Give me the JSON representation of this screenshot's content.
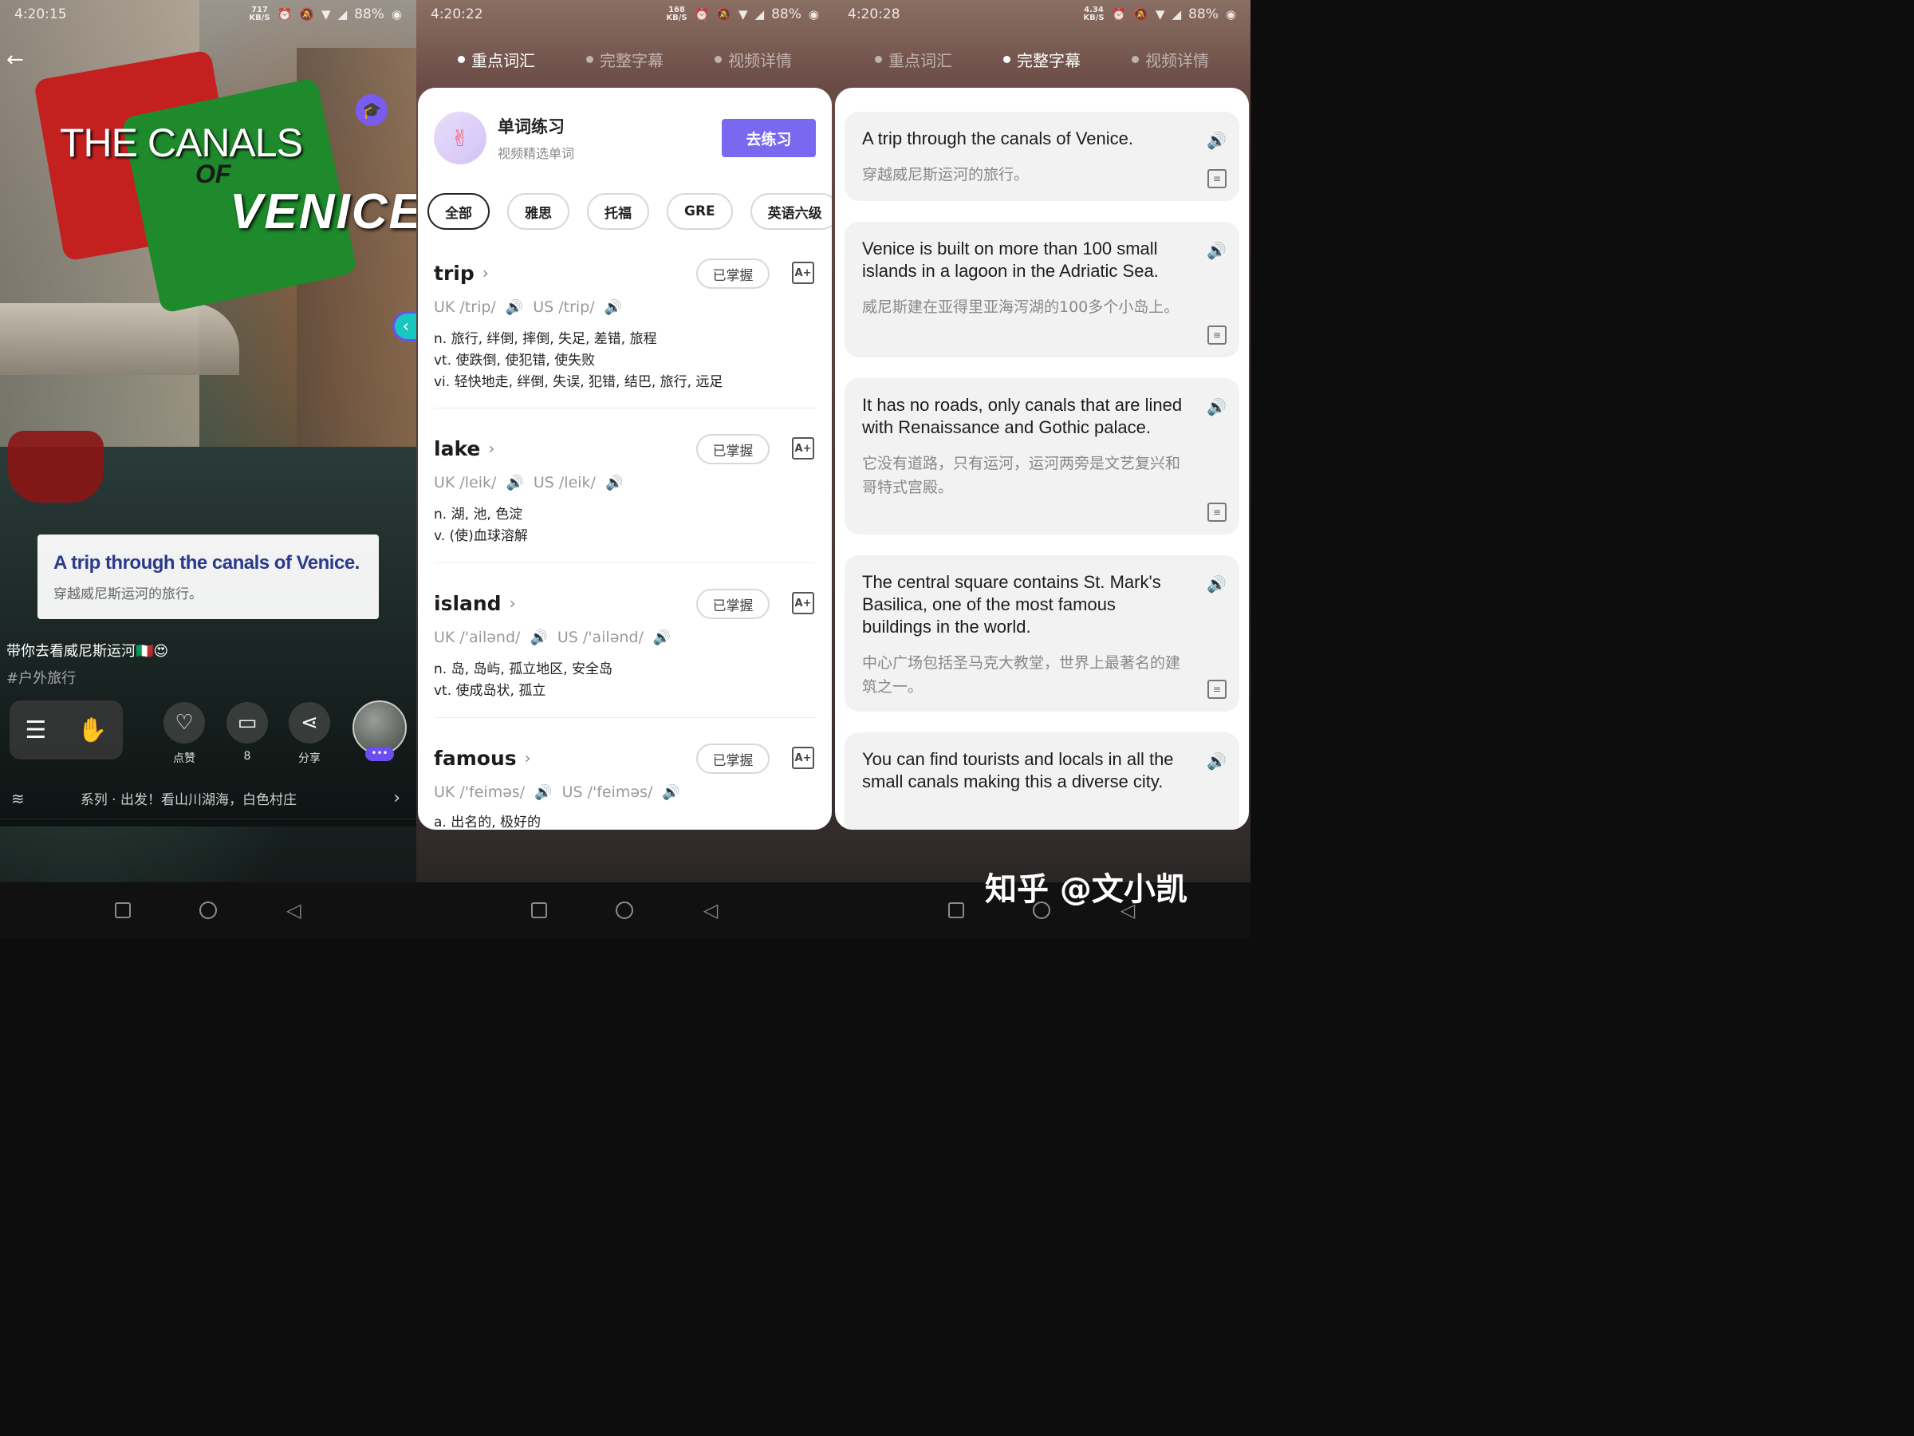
{
  "screen1": {
    "status": {
      "time": "4:20:15",
      "speed": "717",
      "speed_unit": "KB/S",
      "battery": "88%"
    },
    "video_title_line1": "THE CANALS",
    "video_title_line2": "OF",
    "video_title_line3": "VENICE",
    "subtitle_en": "A trip through the canals of Venice.",
    "subtitle_zh": "穿越威尼斯运河的旅行。",
    "caption": "带你去看威尼斯运河🇮🇹😍",
    "hashtag": "#户外旅行",
    "actions": {
      "like": "点赞",
      "comment": "8",
      "share": "分享"
    },
    "avatar_badge": "•••",
    "series": "系列 · 出发！看山川湖海，白色村庄"
  },
  "screen2": {
    "status": {
      "time": "4:20:22",
      "speed": "168",
      "speed_unit": "KB/S",
      "battery": "88%"
    },
    "tabs": [
      "重点词汇",
      "完整字幕",
      "视频详情"
    ],
    "practice": {
      "title": "单词练习",
      "subtitle": "视频精选单词",
      "button": "去练习"
    },
    "filters": [
      "全部",
      "雅思",
      "托福",
      "GRE",
      "英语六级"
    ],
    "mastered_label": "已掌握",
    "words": [
      {
        "word": "trip",
        "uk": "UK /trip/",
        "us": "US /trip/",
        "defs": [
          "n. 旅行, 绊倒, 摔倒, 失足, 差错, 旅程",
          "vt. 使跌倒, 使犯错, 使失败",
          "vi. 轻快地走, 绊倒, 失误, 犯错, 结巴, 旅行, 远足"
        ]
      },
      {
        "word": "lake",
        "uk": "UK /leik/",
        "us": "US /leik/",
        "defs": [
          "n. 湖, 池, 色淀",
          "v. (使)血球溶解"
        ]
      },
      {
        "word": "island",
        "uk": "UK /'ailənd/",
        "us": "US /'ailənd/",
        "defs": [
          "n. 岛, 岛屿, 孤立地区, 安全岛",
          "vt. 使成岛状, 孤立"
        ]
      },
      {
        "word": "famous",
        "uk": "UK /'feiməs/",
        "us": "US /'feiməs/",
        "defs": [
          "a. 出名的, 极好的"
        ]
      }
    ]
  },
  "screen3": {
    "status": {
      "time": "4:20:28",
      "speed": "4.34",
      "speed_unit": "KB/S",
      "battery": "88%"
    },
    "tabs": [
      "重点词汇",
      "完整字幕",
      "视频详情"
    ],
    "subtitles": [
      {
        "en": "A trip through the canals of Venice.",
        "zh": "穿越威尼斯运河的旅行。"
      },
      {
        "en": "Venice is built on more than 100 small islands in a lagoon in the Adriatic Sea.",
        "zh": "威尼斯建在亚得里亚海泻湖的100多个小岛上。"
      },
      {
        "en": "It has no roads, only canals that are lined with Renaissance and Gothic palace.",
        "zh": "它没有道路，只有运河，运河两旁是文艺复兴和哥特式宫殿。"
      },
      {
        "en": "The central square contains St. Mark's Basilica, one of the most famous buildings in the world.",
        "zh": "中心广场包括圣马克大教堂，世界上最著名的建筑之一。"
      },
      {
        "en": "You can find tourists and locals in all the small canals making this a diverse city.",
        "zh": ""
      }
    ]
  },
  "watermark": "知乎 @文小凯"
}
